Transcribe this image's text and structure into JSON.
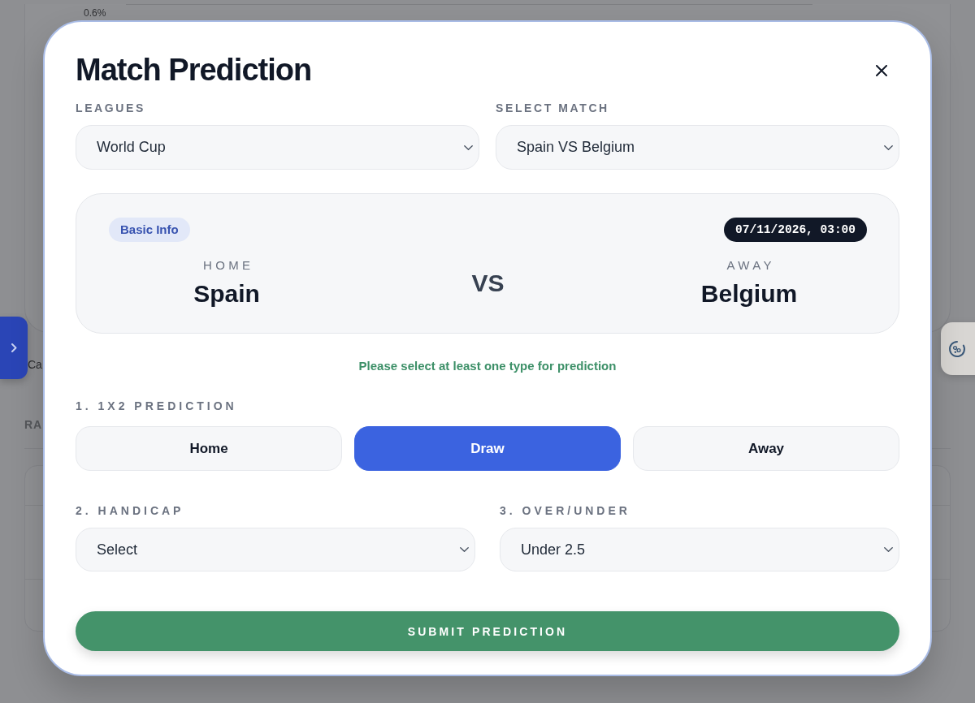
{
  "page_behind": {
    "chart_tick": "0.6%",
    "caption": "Ca",
    "section_heading": "RA"
  },
  "modal": {
    "title": "Match Prediction",
    "selects": [
      {
        "label": "LEAGUES",
        "value": "World Cup"
      },
      {
        "label": "SELECT MATCH",
        "value": "Spain VS Belgium"
      }
    ],
    "match_card": {
      "badge": "Basic Info",
      "kickoff": "07/11/2026, 03:00",
      "home": {
        "label": "HOME",
        "team": "Spain"
      },
      "versus": "VS",
      "away": {
        "label": "AWAY",
        "team": "Belgium"
      }
    },
    "hint": "Please select at least one type for prediction",
    "result_1x2": {
      "label": "1. 1X2 PREDICTION",
      "options": [
        {
          "label": "Home",
          "selected": false
        },
        {
          "label": "Draw",
          "selected": true
        },
        {
          "label": "Away",
          "selected": false
        }
      ]
    },
    "markets": [
      {
        "label": "2. HANDICAP",
        "value": "Select"
      },
      {
        "label": "3. OVER/UNDER",
        "value": "Under 2.5"
      }
    ],
    "submit": "SUBMIT PREDICTION"
  }
}
